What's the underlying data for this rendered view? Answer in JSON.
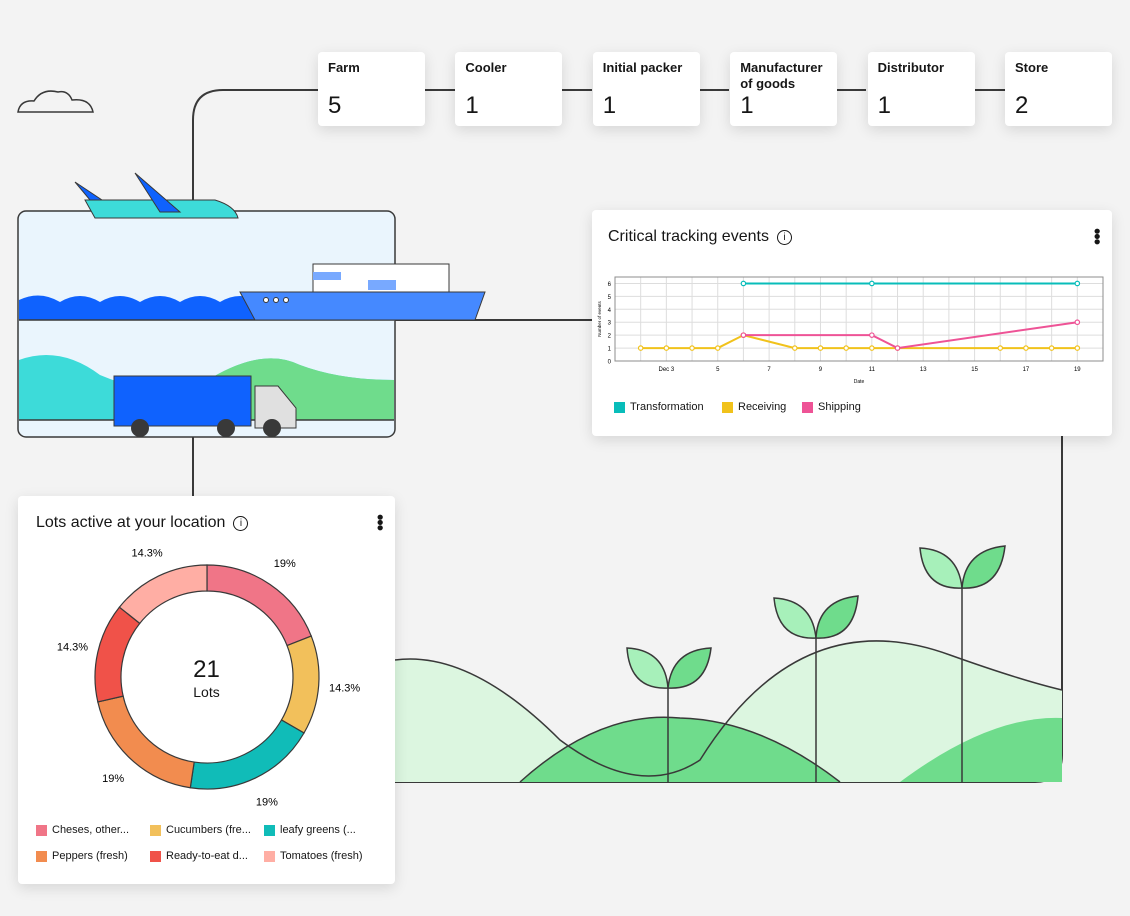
{
  "stages": [
    {
      "label": "Farm",
      "count": "5"
    },
    {
      "label": "Cooler",
      "count": "1"
    },
    {
      "label": "Initial packer",
      "count": "1"
    },
    {
      "label": "Manufacturer of goods",
      "count": "1"
    },
    {
      "label": "Distributor",
      "count": "1"
    },
    {
      "label": "Store",
      "count": "2"
    }
  ],
  "cte": {
    "title": "Critical tracking events",
    "info_icon": "info-icon",
    "menu_icon": "overflow-menu-icon"
  },
  "lots": {
    "title": "Lots active at your location",
    "center_value": "21",
    "center_label": "Lots",
    "info_icon": "info-icon",
    "menu_icon": "overflow-menu-icon"
  },
  "chart_data": [
    {
      "type": "line",
      "xlabel": "Date",
      "ylabel": "Number of events",
      "xlim": [
        1,
        20
      ],
      "ylim": [
        0,
        6.5
      ],
      "x_ticks": [
        {
          "day": 3,
          "label": "Dec 3"
        },
        {
          "day": 5,
          "label": "5"
        },
        {
          "day": 7,
          "label": "7"
        },
        {
          "day": 9,
          "label": "9"
        },
        {
          "day": 11,
          "label": "11"
        },
        {
          "day": 13,
          "label": "13"
        },
        {
          "day": 15,
          "label": "15"
        },
        {
          "day": 17,
          "label": "17"
        },
        {
          "day": 19,
          "label": "19"
        }
      ],
      "y_ticks": [
        0,
        1,
        2,
        3,
        4,
        5,
        6
      ],
      "grid": true,
      "legend": "bottom",
      "series": [
        {
          "name": "Transformation",
          "color": "#08bdba",
          "x": [
            "Dec 6",
            "Dec 11",
            "Dec 19"
          ],
          "days": [
            6,
            11,
            19
          ],
          "values": [
            6,
            6,
            6
          ]
        },
        {
          "name": "Receiving",
          "color": "#f1c21b",
          "days": [
            2,
            3,
            4,
            5,
            6,
            8,
            9,
            10,
            11,
            12,
            16,
            17,
            18,
            19
          ],
          "values": [
            1,
            1,
            1,
            1,
            2,
            1,
            1,
            1,
            1,
            1,
            1,
            1,
            1,
            1
          ]
        },
        {
          "name": "Shipping",
          "color": "#ee5396",
          "days": [
            6,
            11,
            12,
            19
          ],
          "values": [
            2,
            2,
            1,
            3
          ]
        }
      ]
    },
    {
      "type": "pie",
      "donut": true,
      "total": 21,
      "slices": [
        {
          "name": "Cheses, other...",
          "value": 4,
          "label": "19%",
          "color": "#f07587"
        },
        {
          "name": "Cucumbers (fre...",
          "value": 3,
          "label": "14.3%",
          "color": "#f2c05b"
        },
        {
          "name": "leafy greens (...",
          "value": 4,
          "label": "19%",
          "color": "#10bcb8"
        },
        {
          "name": "Peppers (fresh)",
          "value": 4,
          "label": "19%",
          "color": "#f28c4f"
        },
        {
          "name": "Ready-to-eat d...",
          "value": 3,
          "label": "14.3%",
          "color": "#f05249"
        },
        {
          "name": "Tomatoes (fresh)",
          "value": 3,
          "label": "14.3%",
          "color": "#ffaea4"
        }
      ]
    }
  ]
}
